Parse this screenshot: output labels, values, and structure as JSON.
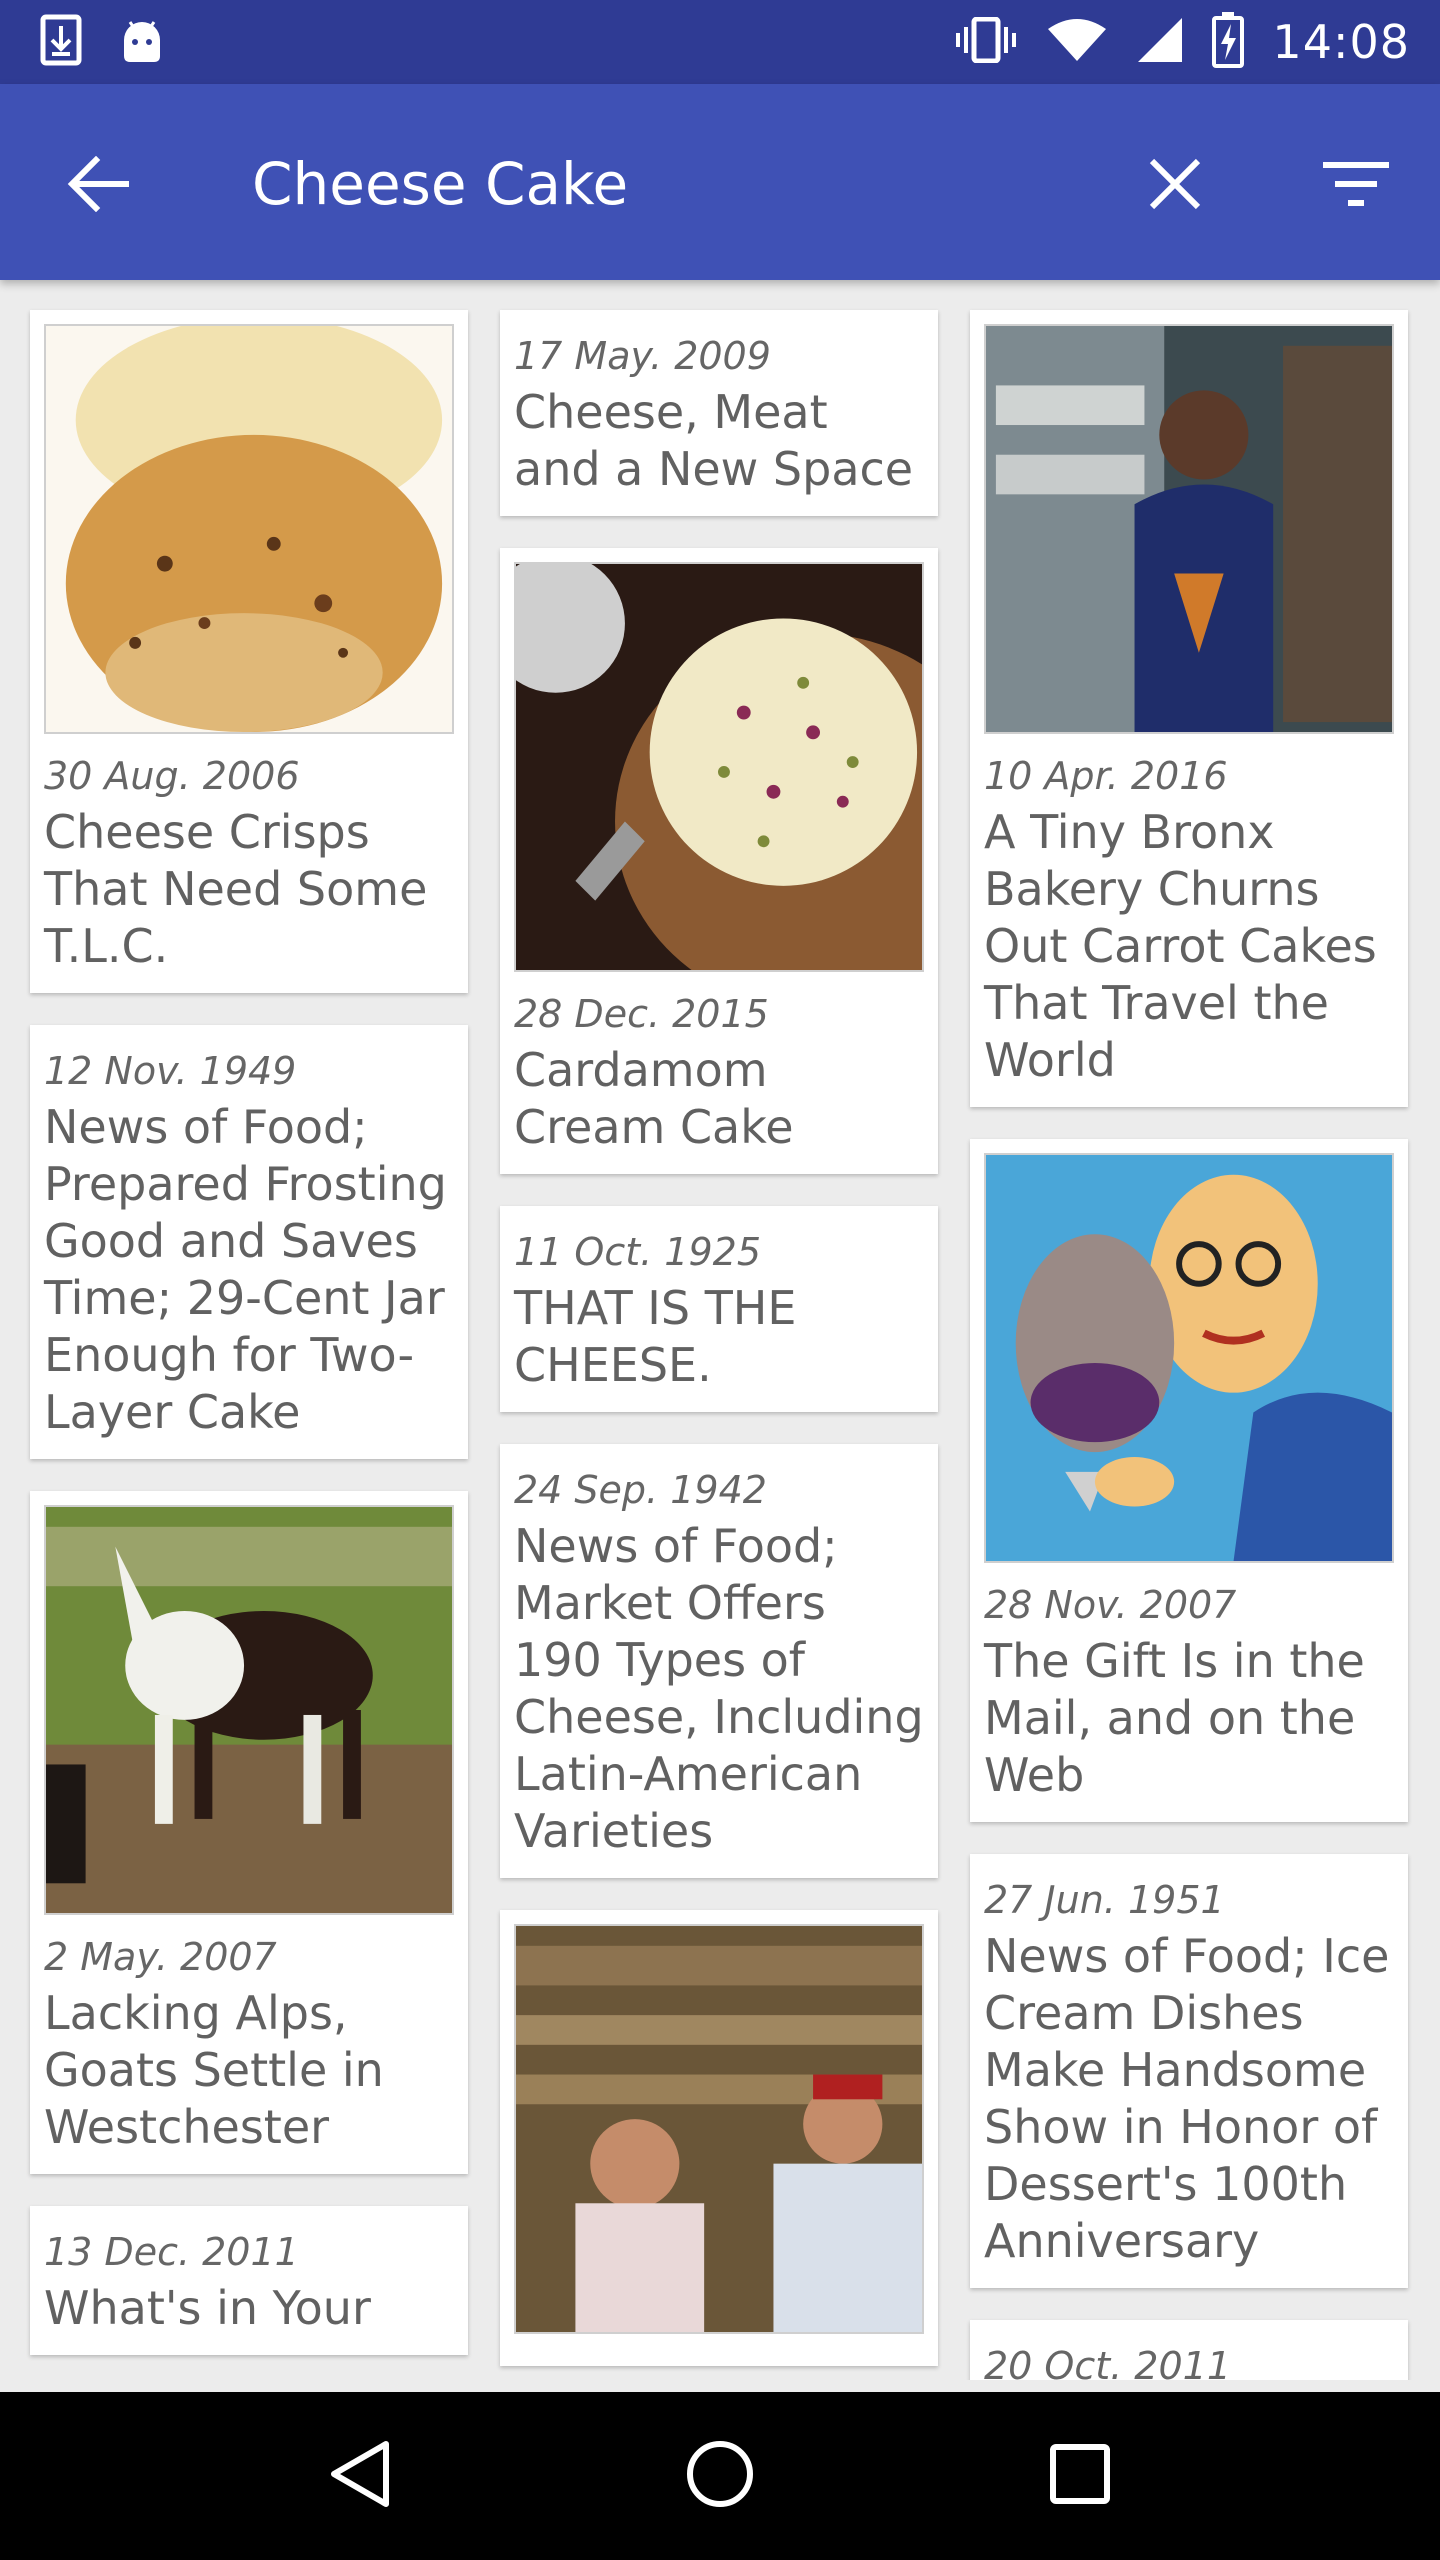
{
  "status_bar": {
    "time": "14:08",
    "icons": [
      "download-icon",
      "android-icon",
      "vibrate-icon",
      "wifi-icon",
      "signal-icon",
      "battery-charging-icon"
    ]
  },
  "app_bar": {
    "query": "Cheese Cake",
    "back_icon": "arrow-back-icon",
    "clear_icon": "close-icon",
    "filter_icon": "filter-icon"
  },
  "articles": {
    "col1": [
      {
        "date": "30 Aug. 2006",
        "title": "Cheese Crisps That Need Some T.L.C.",
        "image": "cheese-crisps-image"
      },
      {
        "date": "12 Nov. 1949",
        "title": "News of Food; Prepared Frosting Good and Saves Time; 29-Cent Jar Enough for Two-Layer Cake"
      },
      {
        "date": "2 May. 2007",
        "title": "Lacking Alps, Goats Settle in Westchester",
        "image": "goat-image"
      },
      {
        "date": "13 Dec. 2011",
        "title": "What's in Your"
      }
    ],
    "col2": [
      {
        "date": "17 May. 2009",
        "title": "Cheese, Meat and a New Space"
      },
      {
        "date": "28 Dec. 2015",
        "title": "Cardamom Cream Cake",
        "image": "cardamom-cake-image"
      },
      {
        "date": "11 Oct. 1925",
        "title": "THAT IS THE CHEESE."
      },
      {
        "date": "24 Sep. 1942",
        "title": "News of Food; Market Offers 190 Types of Cheese, Including Latin-American Varieties"
      },
      {
        "image": "cheese-shop-image"
      }
    ],
    "col3": [
      {
        "date": "10 Apr. 2016",
        "title": "A Tiny Bronx Bakery Churns Out Carrot Cakes That Travel the World",
        "image": "bakery-image"
      },
      {
        "date": "28 Nov. 2007",
        "title": "The Gift Is in the Mail, and on the Web",
        "image": "ice-cream-illustration-image"
      },
      {
        "date": "27 Jun. 1951",
        "title": "News of Food; Ice Cream Dishes Make Handsome Show in Honor of Dessert's 100th Anniversary"
      },
      {
        "date": "20 Oct. 2011"
      }
    ]
  },
  "nav_bar": {
    "back_icon": "nav-back-icon",
    "home_icon": "nav-home-icon",
    "recents_icon": "nav-recents-icon"
  }
}
